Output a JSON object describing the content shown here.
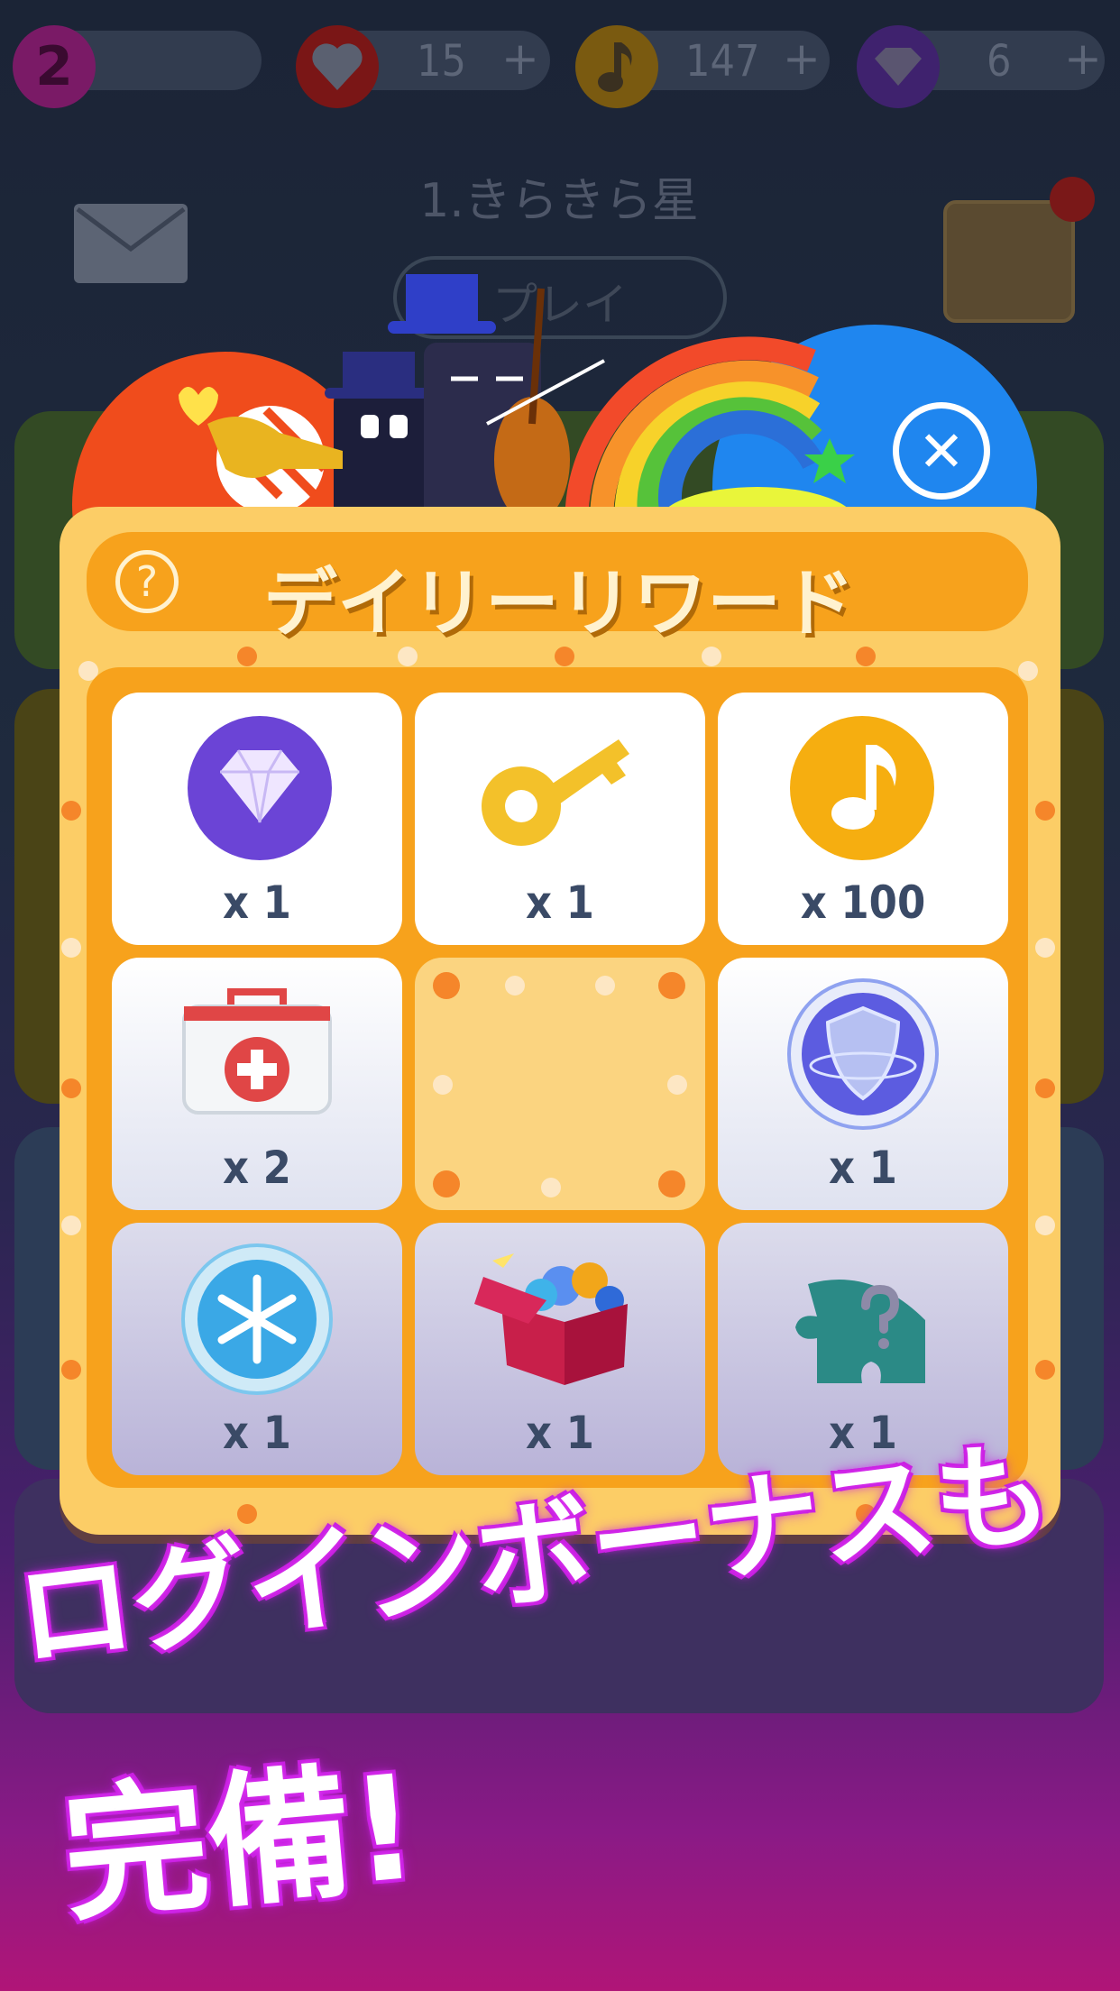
{
  "hud": {
    "level": "2",
    "lives": "15",
    "notes": "147",
    "gems": "6",
    "plus": "+"
  },
  "background": {
    "song_title": "1.きらきら星",
    "play_label": "プレイ"
  },
  "dialog": {
    "title": "デイリーリワード",
    "help_glyph": "?",
    "close_glyph": "✕",
    "rewards": [
      {
        "icon": "diamond-icon",
        "label": "x 1"
      },
      {
        "icon": "key-icon",
        "label": "x 1"
      },
      {
        "icon": "music-note-icon",
        "label": "x 100"
      },
      {
        "icon": "first-aid-kit-icon",
        "label": "x 2"
      },
      {
        "icon": "empty-slot",
        "label": ""
      },
      {
        "icon": "shield-icon",
        "label": "x 1"
      },
      {
        "icon": "snowflake-icon",
        "label": "x 1"
      },
      {
        "icon": "gift-box-icon",
        "label": "x 1"
      },
      {
        "icon": "puzzle-piece-icon",
        "label": "x 1"
      }
    ]
  },
  "promo": {
    "line1": "ログインボーナスも",
    "line2": "完備!"
  },
  "colors": {
    "panel": "#fccd66",
    "panel_border": "#f7a21c",
    "diamond": "#6b44d6",
    "note": "#f6ae10",
    "text": "#3a4a66"
  }
}
